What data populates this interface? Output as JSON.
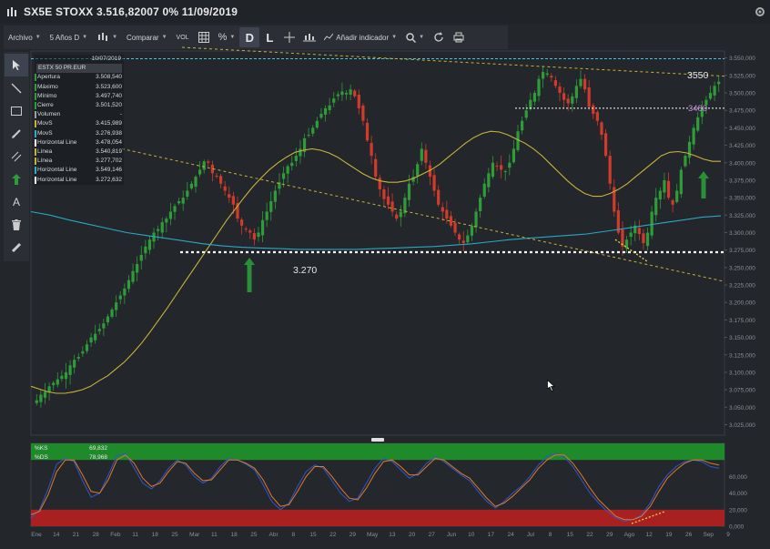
{
  "window": {
    "title": "SX5E STOXX 3.516,82007 0% 11/09/2019"
  },
  "toolbar": {
    "file": "Archivo",
    "period": "5 Años D",
    "compare": "Comparar",
    "volume": "VOL",
    "percent": "%",
    "daily": "D",
    "last": "L",
    "add_indicator": "Añadir indicador"
  },
  "legend": {
    "date": "10/07/2019",
    "instrument": "ESTX 50 PR.EUR",
    "rows": [
      {
        "label": "Apertura",
        "value": "3.508,540",
        "color": "#2f9c3a"
      },
      {
        "label": "Máximo",
        "value": "3.523,600",
        "color": "#2f9c3a"
      },
      {
        "label": "Mínimo",
        "value": "3.497,740",
        "color": "#2f9c3a"
      },
      {
        "label": "Cierre",
        "value": "3.501,520",
        "color": "#2f9c3a"
      },
      {
        "label": "Volumen",
        "value": "-",
        "color": "#9aa0a6"
      },
      {
        "label": "MovS",
        "value": "3.415,989",
        "color": "#c8b33a"
      },
      {
        "label": "MovS",
        "value": "3.276,938",
        "color": "#2ab0c8"
      },
      {
        "label": "Horizontal Line",
        "value": "3.478,054",
        "color": "#ffffff"
      },
      {
        "label": "Línea",
        "value": "3.540,819",
        "color": "#c8b33a"
      },
      {
        "label": "Línea",
        "value": "3.277,702",
        "color": "#c8b33a"
      },
      {
        "label": "Horizontal Line",
        "value": "3.549,146",
        "color": "#2ab0c8"
      },
      {
        "label": "Horizontal Line",
        "value": "3.272,632",
        "color": "#ffffff"
      }
    ]
  },
  "annotations": {
    "support": "3.270",
    "resistance_top": "3550",
    "resistance_mid": "3480"
  },
  "stoch_legend": [
    {
      "label": "%KS",
      "value": "69,832"
    },
    {
      "label": "%DS",
      "value": "78,968"
    }
  ],
  "colors": {
    "bull": "#2f9c3a",
    "bear": "#d23a2c",
    "ma_fast": "#c8b33a",
    "ma_slow": "#2aa7c4",
    "background": "#23262b",
    "overbought": "#1f8a2a",
    "oversold": "#a82020"
  },
  "chart_data": {
    "type": "candlestick",
    "y_axis_labels": [
      "3.550,000",
      "3.525,000",
      "3.500,000",
      "3.475,000",
      "3.450,000",
      "3.425,000",
      "3.400,000",
      "3.375,000",
      "3.350,000",
      "3.325,000",
      "3.300,000",
      "3.275,000",
      "3.250,000",
      "3.225,000",
      "3.200,000",
      "3.175,000",
      "3.150,000",
      "3.125,000",
      "3.100,000",
      "3.075,000",
      "3.050,000",
      "3.025,000"
    ],
    "ylim": [
      3010,
      3560
    ],
    "x_axis_labels": [
      "Ene",
      "14",
      "21",
      "28",
      "Feb",
      "11",
      "18",
      "25",
      "Mar",
      "11",
      "18",
      "25",
      "Abr",
      "8",
      "15",
      "22",
      "29",
      "May",
      "13",
      "20",
      "27",
      "Jun",
      "10",
      "17",
      "24",
      "Jul",
      "8",
      "15",
      "22",
      "29",
      "Ago",
      "12",
      "19",
      "26",
      "Sep",
      "9"
    ],
    "close_series": [
      3060,
      3068,
      3072,
      3080,
      3085,
      3090,
      3095,
      3100,
      3110,
      3118,
      3122,
      3130,
      3140,
      3150,
      3155,
      3162,
      3170,
      3180,
      3190,
      3200,
      3210,
      3220,
      3232,
      3245,
      3255,
      3268,
      3280,
      3290,
      3300,
      3305,
      3315,
      3320,
      3330,
      3338,
      3345,
      3350,
      3360,
      3370,
      3380,
      3390,
      3402,
      3400,
      3385,
      3380,
      3370,
      3360,
      3350,
      3340,
      3320,
      3310,
      3305,
      3300,
      3290,
      3300,
      3318,
      3330,
      3345,
      3360,
      3372,
      3385,
      3395,
      3400,
      3410,
      3420,
      3435,
      3440,
      3450,
      3460,
      3470,
      3478,
      3482,
      3492,
      3498,
      3502,
      3500,
      3505,
      3495,
      3478,
      3460,
      3432,
      3410,
      3380,
      3362,
      3348,
      3340,
      3330,
      3320,
      3330,
      3350,
      3370,
      3380,
      3398,
      3420,
      3400,
      3380,
      3360,
      3340,
      3330,
      3320,
      3310,
      3300,
      3290,
      3285,
      3296,
      3310,
      3330,
      3350,
      3370,
      3385,
      3400,
      3395,
      3390,
      3388,
      3400,
      3420,
      3445,
      3460,
      3475,
      3490,
      3500,
      3520,
      3530,
      3528,
      3522,
      3510,
      3500,
      3490,
      3485,
      3495,
      3510,
      3520,
      3505,
      3480,
      3470,
      3460,
      3440,
      3410,
      3370,
      3330,
      3300,
      3280,
      3290,
      3300,
      3310,
      3298,
      3285,
      3300,
      3330,
      3350,
      3360,
      3375,
      3350,
      3340,
      3360,
      3390,
      3410,
      3430,
      3450,
      3465,
      3478,
      3490,
      3500,
      3510,
      3516
    ],
    "ma_fast_series": [
      3080,
      3076,
      3072,
      3070,
      3070,
      3072,
      3075,
      3080,
      3088,
      3095,
      3105,
      3115,
      3128,
      3142,
      3158,
      3175,
      3192,
      3210,
      3228,
      3246,
      3264,
      3282,
      3300,
      3318,
      3334,
      3350,
      3365,
      3378,
      3390,
      3400,
      3408,
      3415,
      3418,
      3420,
      3418,
      3414,
      3408,
      3400,
      3392,
      3384,
      3378,
      3374,
      3372,
      3372,
      3374,
      3378,
      3384,
      3390,
      3398,
      3408,
      3418,
      3428,
      3436,
      3442,
      3445,
      3444,
      3440,
      3434,
      3428,
      3420,
      3410,
      3398,
      3386,
      3374,
      3364,
      3356,
      3352,
      3352,
      3356,
      3362,
      3370,
      3380,
      3390,
      3400,
      3410,
      3415,
      3416,
      3414,
      3410,
      3405,
      3402,
      3402
    ],
    "ma_slow_series": [
      3330,
      3325,
      3318,
      3312,
      3306,
      3300,
      3296,
      3292,
      3288,
      3284,
      3281,
      3279,
      3278,
      3277,
      3276,
      3276,
      3276,
      3276,
      3277,
      3278,
      3279,
      3280,
      3282,
      3284,
      3287,
      3290,
      3292,
      3294,
      3296,
      3298,
      3302,
      3306,
      3310,
      3314,
      3318,
      3322,
      3324
    ],
    "stochastic": {
      "upper_band": 80,
      "lower_band": 20,
      "y_axis_labels": [
        "60,000",
        "40,000",
        "20,000",
        "0,000"
      ],
      "ks": [
        10,
        20,
        45,
        75,
        82,
        78,
        55,
        35,
        40,
        62,
        85,
        88,
        70,
        52,
        45,
        55,
        70,
        80,
        74,
        60,
        52,
        58,
        72,
        82,
        80,
        75,
        68,
        50,
        30,
        20,
        28,
        48,
        66,
        74,
        70,
        55,
        40,
        30,
        34,
        52,
        70,
        82,
        78,
        68,
        58,
        64,
        76,
        84,
        78,
        70,
        62,
        55,
        42,
        30,
        22,
        30,
        40,
        48,
        60,
        74,
        84,
        88,
        84,
        72,
        56,
        40,
        28,
        18,
        10,
        6,
        8,
        14,
        28,
        48,
        62,
        72,
        78,
        80,
        78,
        72,
        70
      ],
      "ds": [
        14,
        18,
        38,
        66,
        80,
        80,
        62,
        42,
        40,
        56,
        80,
        86,
        76,
        58,
        48,
        52,
        66,
        78,
        76,
        64,
        55,
        56,
        68,
        80,
        80,
        76,
        70,
        56,
        36,
        24,
        26,
        42,
        60,
        72,
        72,
        60,
        46,
        34,
        32,
        46,
        64,
        78,
        80,
        72,
        62,
        62,
        72,
        82,
        80,
        72,
        64,
        58,
        46,
        34,
        24,
        28,
        36,
        46,
        56,
        70,
        80,
        86,
        86,
        76,
        62,
        46,
        32,
        22,
        12,
        8,
        8,
        12,
        24,
        42,
        58,
        68,
        76,
        80,
        80,
        76,
        74
      ]
    }
  }
}
